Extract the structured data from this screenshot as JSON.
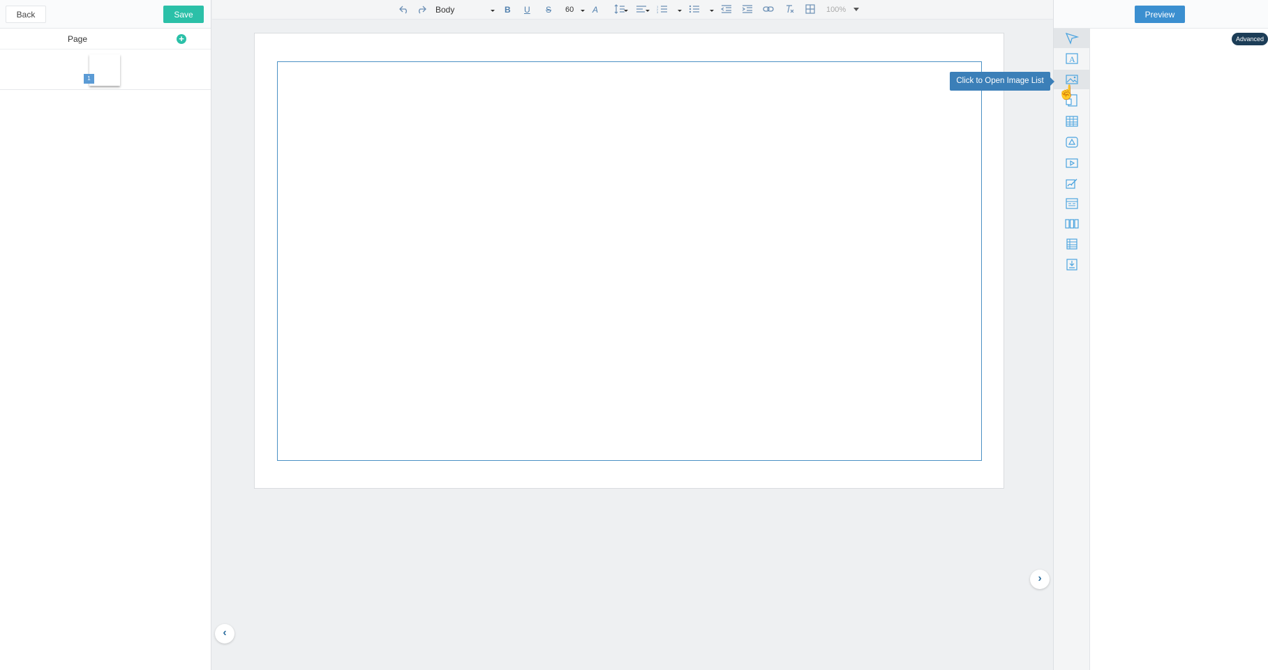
{
  "left": {
    "back_label": "Back",
    "save_label": "Save",
    "page_label": "Page",
    "add_icon": "plus-circle-icon",
    "thumbnails": [
      {
        "number": "1"
      }
    ]
  },
  "toolbar": {
    "style_value": "Body",
    "font_size": "60",
    "zoom": "100%",
    "icons": [
      "undo-icon",
      "redo-icon",
      "bold-icon",
      "underline-icon",
      "strikethrough-icon",
      "text-color-icon",
      "line-height-icon",
      "align-icon",
      "ordered-list-icon",
      "unordered-list-icon",
      "outdent-icon",
      "indent-icon",
      "link-icon",
      "clear-format-icon",
      "table-icon"
    ]
  },
  "right": {
    "preview_label": "Preview",
    "advanced_label": "Advanced",
    "tools": [
      "pointer-icon",
      "text-box-icon",
      "image-icon",
      "document-icon",
      "table-icon",
      "shape-icon",
      "video-icon",
      "signature-icon",
      "form-icon",
      "columns-icon",
      "list-icon",
      "download-icon"
    ]
  },
  "tooltip": {
    "text": "Click to Open Image List"
  },
  "colors": {
    "accent_green": "#2bc0a8",
    "accent_blue": "#3b8fd0",
    "frame_blue": "#4a90c4"
  }
}
